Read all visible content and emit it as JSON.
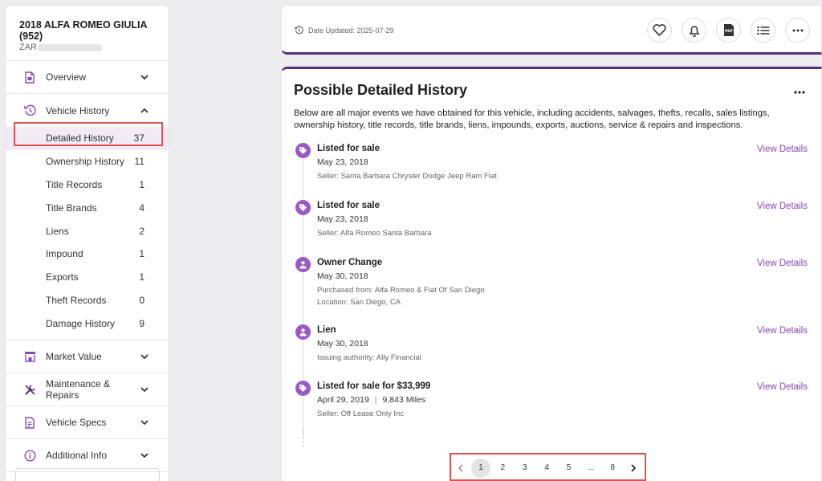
{
  "vehicle": {
    "title": "2018 ALFA ROMEO GIULIA (952)",
    "vin_prefix": "ZAR"
  },
  "sidebar": {
    "overview": "Overview",
    "vehicle_history": "Vehicle History",
    "history_items": [
      {
        "label": "Detailed History",
        "count": "37"
      },
      {
        "label": "Ownership History",
        "count": "11"
      },
      {
        "label": "Title Records",
        "count": "1"
      },
      {
        "label": "Title Brands",
        "count": "4"
      },
      {
        "label": "Liens",
        "count": "2"
      },
      {
        "label": "Impound",
        "count": "1"
      },
      {
        "label": "Exports",
        "count": "1"
      },
      {
        "label": "Theft Records",
        "count": "0"
      },
      {
        "label": "Damage History",
        "count": "9"
      }
    ],
    "market_value": "Market Value",
    "maintenance": "Maintenance & Repairs",
    "vehicle_specs": "Vehicle Specs",
    "additional_info": "Additional Info"
  },
  "header": {
    "date_updated": "Date Updated: 2025-07-29"
  },
  "main": {
    "title": "Possible Detailed History",
    "description": "Below are all major events we have obtained for this vehicle, including accidents, salvages, thefts, recalls, sales listings, ownership history, title records, title brands, liens, impounds, exports, auctions, service & repairs and inspections.",
    "view_details": "View Details",
    "events": [
      {
        "type": "Listed for sale",
        "date": "May 23, 2018",
        "details": [
          "Seller: Santa Barbara Chrysler Dodge Jeep Ram Fiat"
        ]
      },
      {
        "type": "Listed for sale",
        "date": "May 23, 2018",
        "details": [
          "Seller: Alfa Romeo Santa Barbara"
        ]
      },
      {
        "type": "Owner Change",
        "date": "May 30, 2018",
        "details": [
          "Purchased from: Alfa Romeo & Fiat Of San Diego",
          "Location: San Diego, CA"
        ]
      },
      {
        "type": "Lien",
        "date": "May 30, 2018",
        "details": [
          "Issuing authority: Ally Financial"
        ]
      },
      {
        "type": "Listed for sale for $33,999",
        "date": "April 29, 2019",
        "mileage": "9,843 Miles",
        "details": [
          "Seller: Off Lease Only Inc"
        ]
      }
    ]
  },
  "pagination": {
    "prev": "‹",
    "pages": [
      "1",
      "2",
      "3",
      "4",
      "5",
      "...",
      "8"
    ],
    "next": "›",
    "current": "1"
  },
  "colors": {
    "accent": "#5a2e78",
    "icon_purple": "#9b59c7",
    "link": "#8a47b8",
    "highlight_box": "#e05252"
  }
}
